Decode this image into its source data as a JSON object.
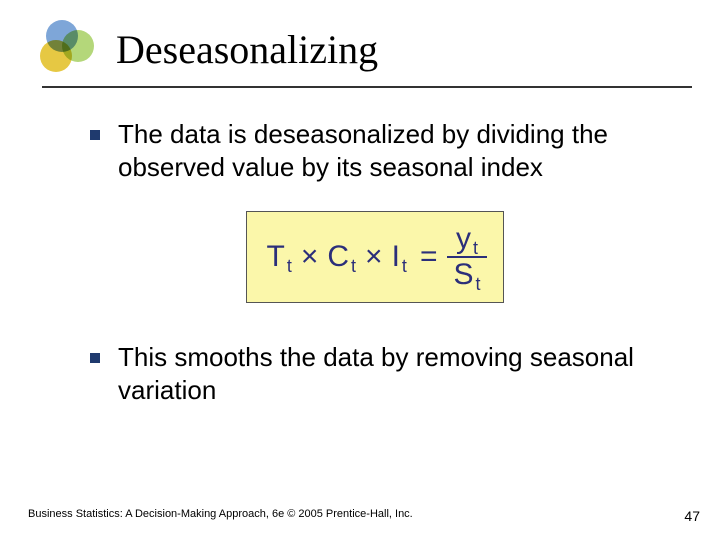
{
  "slide": {
    "title": "Deseasonalizing",
    "bullets": [
      "The data is deseasonalized by dividing the observed value by its seasonal index",
      "This smooths the data by removing seasonal variation"
    ],
    "formula": {
      "lhs_terms": [
        {
          "var": "T",
          "sub": "t"
        },
        {
          "var": "C",
          "sub": "t"
        },
        {
          "var": "I",
          "sub": "t"
        }
      ],
      "operator": "×",
      "equals": "=",
      "rhs_num": {
        "var": "y",
        "sub": "t"
      },
      "rhs_den": {
        "var": "S",
        "sub": "t"
      }
    },
    "footer_left": "Business Statistics: A Decision-Making Approach, 6e © 2005 Prentice-Hall, Inc.",
    "page_number": "47"
  }
}
